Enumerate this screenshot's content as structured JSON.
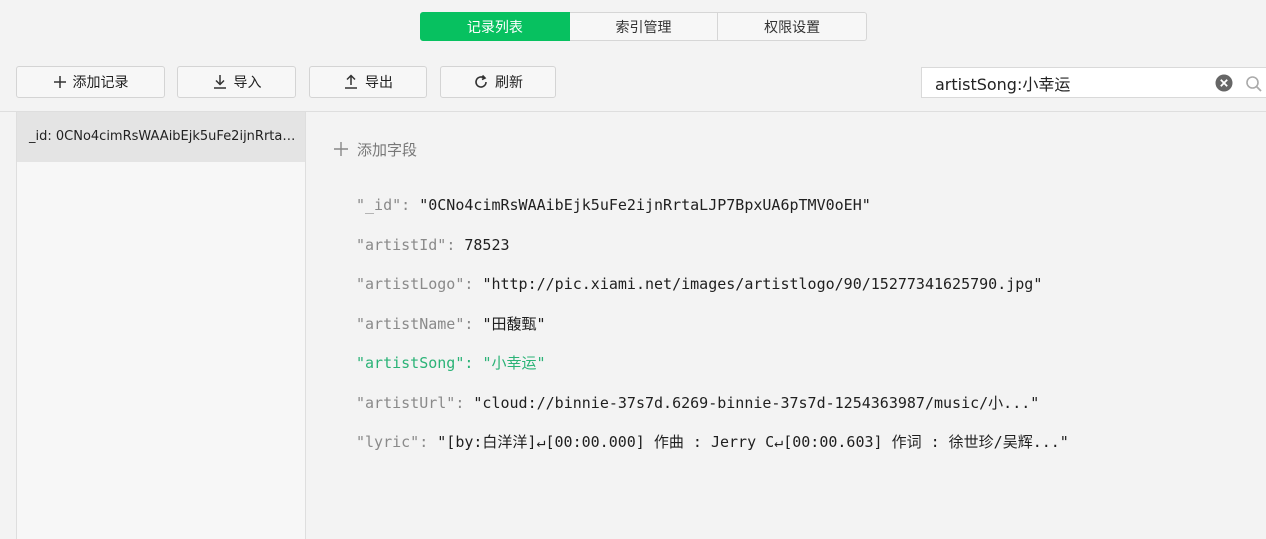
{
  "tabs": [
    {
      "label": "记录列表",
      "active": true
    },
    {
      "label": "索引管理",
      "active": false
    },
    {
      "label": "权限设置",
      "active": false
    }
  ],
  "toolbar": {
    "add_label": "添加记录",
    "import_label": "导入",
    "export_label": "导出",
    "refresh_label": "刷新"
  },
  "search": {
    "value": "artistSong:小幸运",
    "icons": [
      "clear-icon",
      "search-icon"
    ]
  },
  "records": [
    {
      "label": "_id: 0CNo4cimRsWAAibEjk5uFe2ijnRrtaLJP7BpxUA6pTMV0oEH"
    }
  ],
  "detail": {
    "add_field_label": "添加字段",
    "fields": [
      {
        "key": "\"_id\"",
        "value": "\"0CNo4cimRsWAAibEjk5uFe2ijnRrtaLJP7BpxUA6pTMV0oEH\""
      },
      {
        "key": "\"artistId\"",
        "value": "78523"
      },
      {
        "key": "\"artistLogo\"",
        "value": "\"http://pic.xiami.net/images/artistlogo/90/15277341625790.jpg\""
      },
      {
        "key": "\"artistName\"",
        "value": "\"田馥甄\""
      },
      {
        "key": "\"artistSong\"",
        "value": "\"小幸运\"",
        "highlight": true
      },
      {
        "key": "\"artistUrl\"",
        "value": "\"cloud://binnie-37s7d.6269-binnie-37s7d-1254363987/music/小...\""
      },
      {
        "key": "\"lyric\"",
        "value": "\"[by:白洋洋]↵[00:00.000] 作曲 : Jerry C↵[00:00.603] 作词 : 徐世珍/吴辉...\""
      }
    ]
  },
  "colors": {
    "accent": "#07c160",
    "highlight": "#2bb377"
  }
}
